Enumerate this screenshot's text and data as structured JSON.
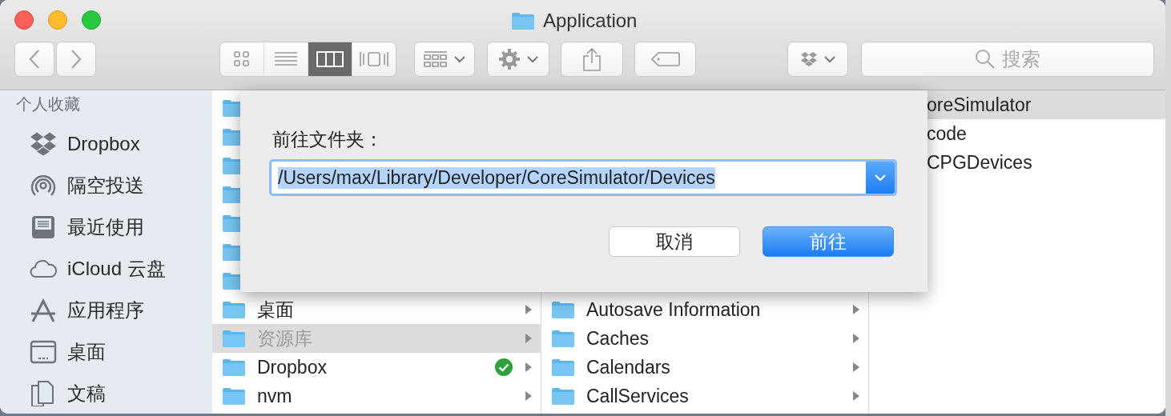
{
  "window": {
    "title": "Application"
  },
  "toolbar": {
    "view_modes": [
      {
        "selected": false
      },
      {
        "selected": false
      },
      {
        "selected": true
      },
      {
        "selected": false
      }
    ],
    "search": {
      "placeholder": "搜索"
    }
  },
  "sidebar": {
    "heading": "个人收藏",
    "items": [
      {
        "label": "Dropbox"
      },
      {
        "label": "隔空投送"
      },
      {
        "label": "最近使用"
      },
      {
        "label": "iCloud 云盘"
      },
      {
        "label": "应用程序"
      },
      {
        "label": "桌面"
      },
      {
        "label": "文稿"
      }
    ]
  },
  "columns": [
    {
      "rows": [
        {
          "selected": false
        },
        {
          "selected": false
        },
        {
          "selected": false
        },
        {
          "selected": false
        },
        {
          "selected": false
        },
        {
          "selected": false
        },
        {
          "selected": false
        },
        {
          "name": "桌面",
          "selected": false,
          "synced": false
        },
        {
          "name": "资源库",
          "selected": true,
          "synced": false
        },
        {
          "name": "Dropbox",
          "selected": false,
          "synced": true
        },
        {
          "name": "nvm",
          "selected": false,
          "synced": false
        }
      ]
    },
    {
      "rows": [
        {
          "name": "Autosave Information",
          "selected": false
        },
        {
          "name": "Caches",
          "selected": false
        },
        {
          "name": "Calendars",
          "selected": false
        },
        {
          "name": "CallServices",
          "selected": false
        }
      ]
    },
    {
      "rows": [
        {
          "name": "oreSimulator",
          "selected": true
        },
        {
          "name": "code",
          "selected": false
        },
        {
          "name": "CPGDevices",
          "selected": false
        }
      ]
    }
  ],
  "dialog": {
    "label": "前往文件夹：",
    "path": {
      "value": "/Users/max/Library/Developer/CoreSimulator/Devices",
      "text_selected": true
    },
    "buttons": [
      {
        "label": "取消",
        "default": false
      },
      {
        "label": "前往",
        "default": true
      }
    ]
  }
}
